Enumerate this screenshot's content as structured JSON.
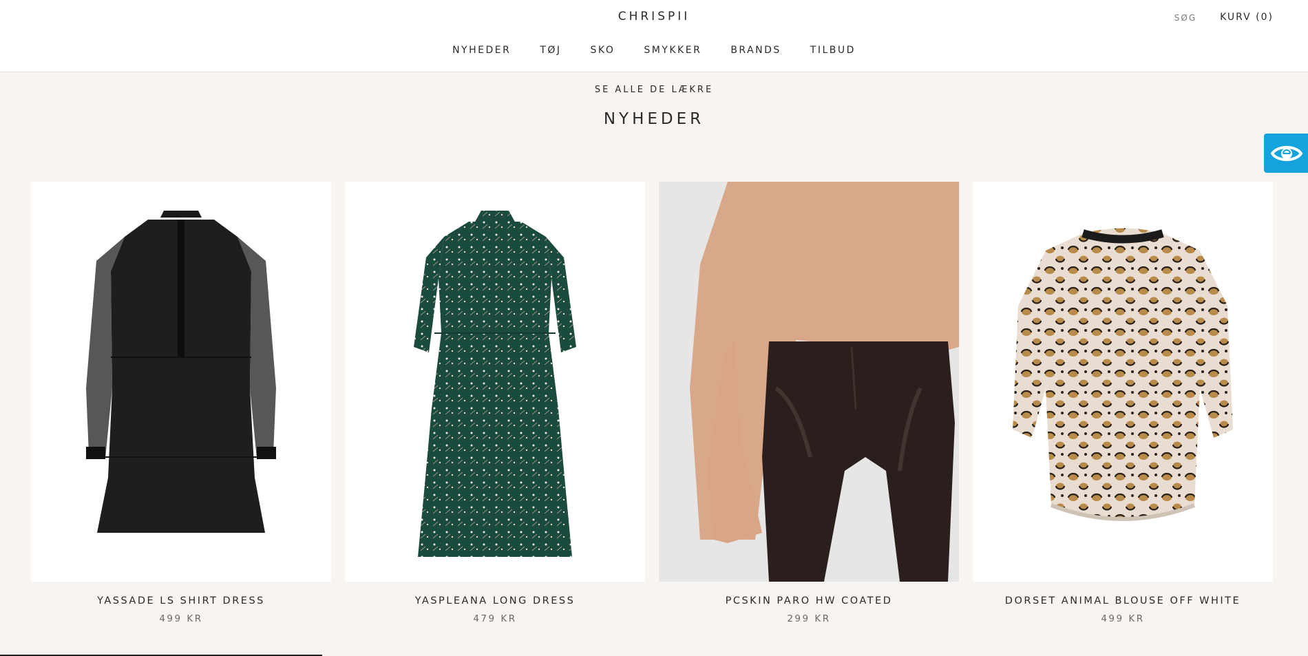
{
  "header": {
    "logo": "CHRISPII",
    "search_label": "SØG",
    "cart_label": "KURV (0)"
  },
  "nav": {
    "items": [
      "NYHEDER",
      "TØJ",
      "SKO",
      "SMYKKER",
      "BRANDS",
      "TILBUD"
    ]
  },
  "section": {
    "eyebrow": "SE ALLE DE LÆKRE",
    "title": "NYHEDER"
  },
  "products": [
    {
      "name": "YASSADE LS SHIRT DRESS",
      "price": "499 KR",
      "image_icon": "black-shirt-dress-image"
    },
    {
      "name": "YASPLEANA LONG DRESS",
      "price": "479 KR",
      "image_icon": "green-floral-dress-image"
    },
    {
      "name": "PCSKIN PARO HW COATED",
      "price": "299 KR",
      "image_icon": "coated-leggings-image"
    },
    {
      "name": "DORSET ANIMAL BLOUSE OFF WHITE",
      "price": "499 KR",
      "image_icon": "leopard-blouse-image"
    }
  ],
  "widgets": {
    "accessibility_icon": "eye-icon",
    "accent_color": "#15a3dd"
  }
}
